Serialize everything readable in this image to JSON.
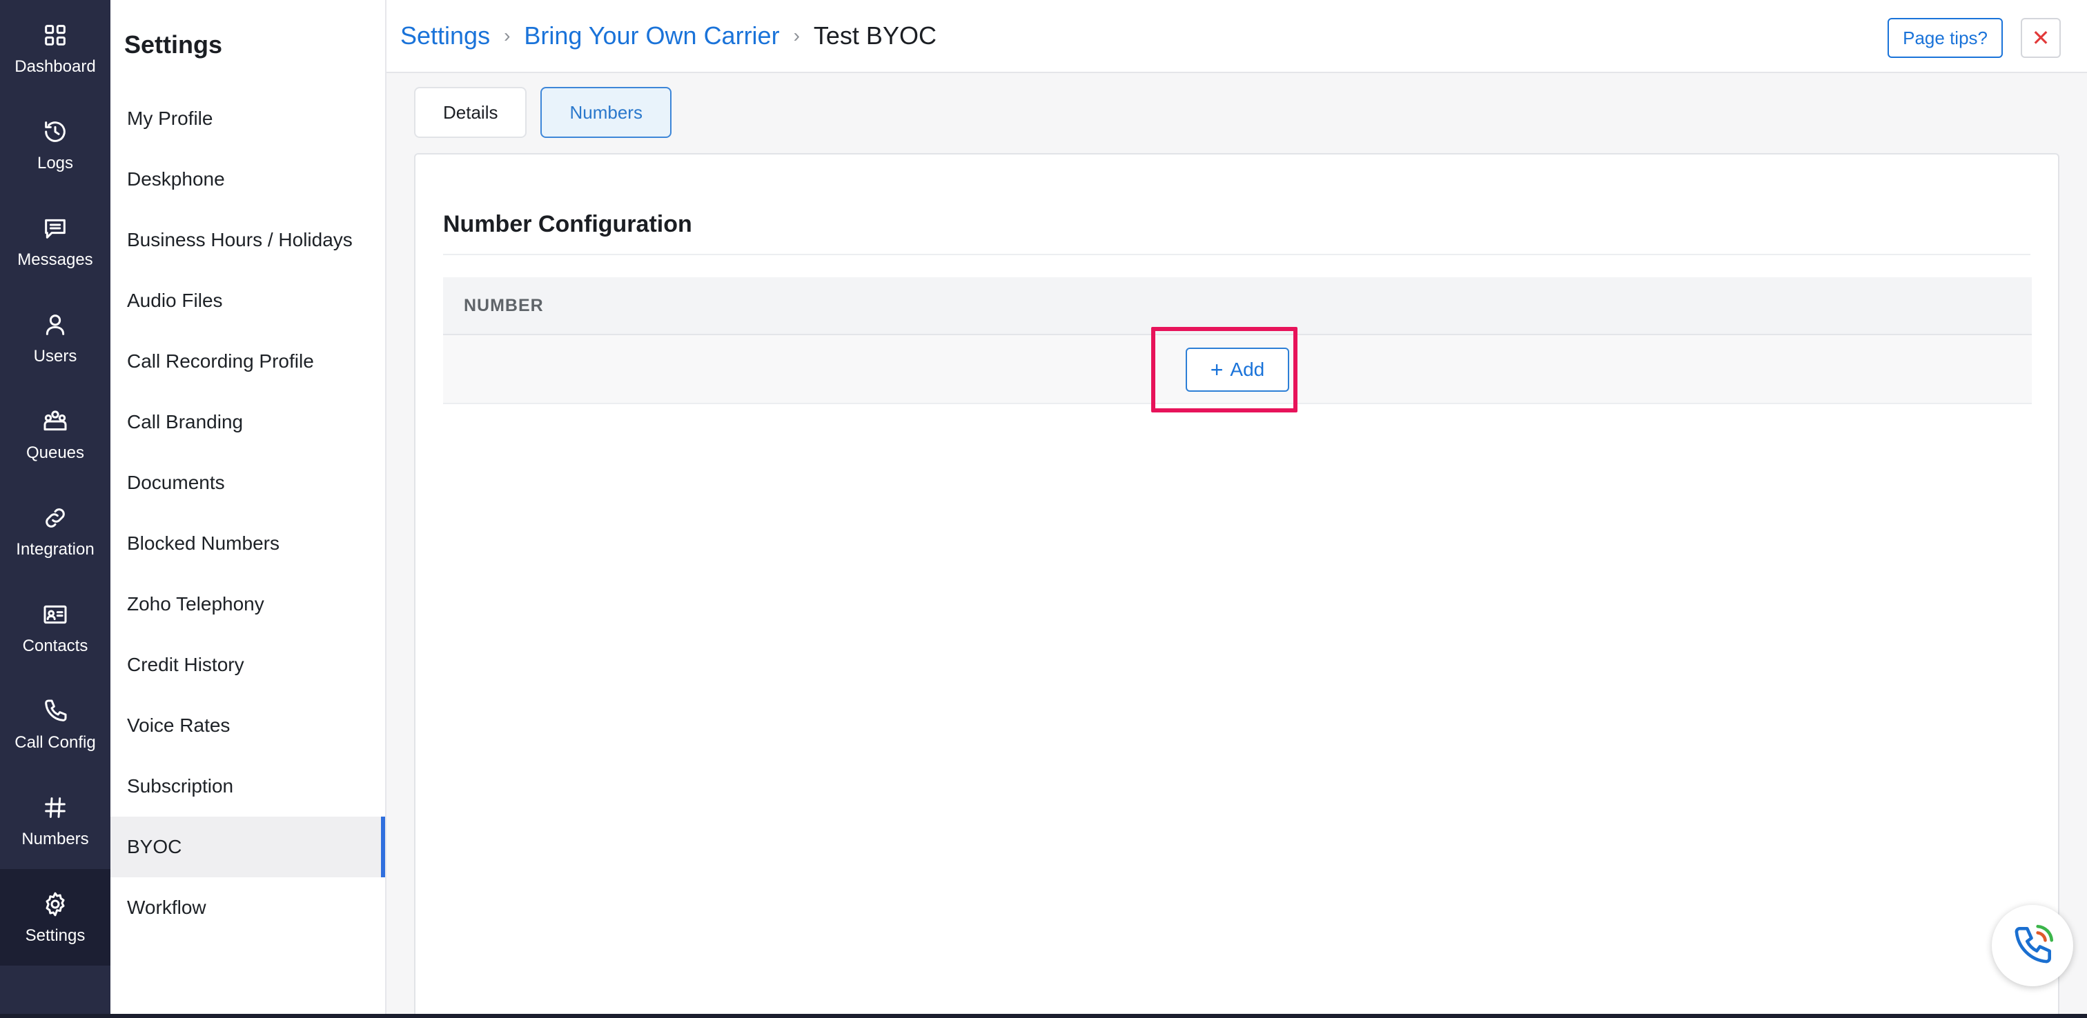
{
  "rail": {
    "items": [
      {
        "label": "Dashboard",
        "icon": "grid-icon"
      },
      {
        "label": "Logs",
        "icon": "history-icon"
      },
      {
        "label": "Messages",
        "icon": "message-icon"
      },
      {
        "label": "Users",
        "icon": "user-icon"
      },
      {
        "label": "Queues",
        "icon": "queues-icon"
      },
      {
        "label": "Integration",
        "icon": "link-icon"
      },
      {
        "label": "Contacts",
        "icon": "contact-card-icon"
      },
      {
        "label": "Call Config",
        "icon": "phone-icon"
      },
      {
        "label": "Numbers",
        "icon": "hash-icon"
      },
      {
        "label": "Settings",
        "icon": "gear-icon",
        "active": true
      }
    ]
  },
  "submenu": {
    "title": "Settings",
    "items": [
      {
        "label": "My Profile"
      },
      {
        "label": "Deskphone"
      },
      {
        "label": "Business Hours / Holidays"
      },
      {
        "label": "Audio Files"
      },
      {
        "label": "Call Recording Profile"
      },
      {
        "label": "Call Branding"
      },
      {
        "label": "Documents"
      },
      {
        "label": "Blocked Numbers"
      },
      {
        "label": "Zoho Telephony"
      },
      {
        "label": "Credit History"
      },
      {
        "label": "Voice Rates"
      },
      {
        "label": "Subscription"
      },
      {
        "label": "BYOC",
        "active": true
      },
      {
        "label": "Workflow"
      }
    ]
  },
  "breadcrumb": {
    "root": "Settings",
    "parent": "Bring Your Own Carrier",
    "current": "Test BYOC",
    "separator": "›"
  },
  "actions": {
    "tips_label": "Page tips?",
    "close_glyph": "✕"
  },
  "tabs": [
    {
      "label": "Details",
      "active": false
    },
    {
      "label": "Numbers",
      "active": true
    }
  ],
  "panel": {
    "title": "Number Configuration",
    "table": {
      "columns": [
        "NUMBER"
      ],
      "add_label": "Add",
      "add_glyph": "+"
    }
  },
  "colors": {
    "rail_bg": "#282c44",
    "accent": "#1a73d9",
    "highlight": "#e7135a",
    "active_indicator": "#2f6fde"
  }
}
